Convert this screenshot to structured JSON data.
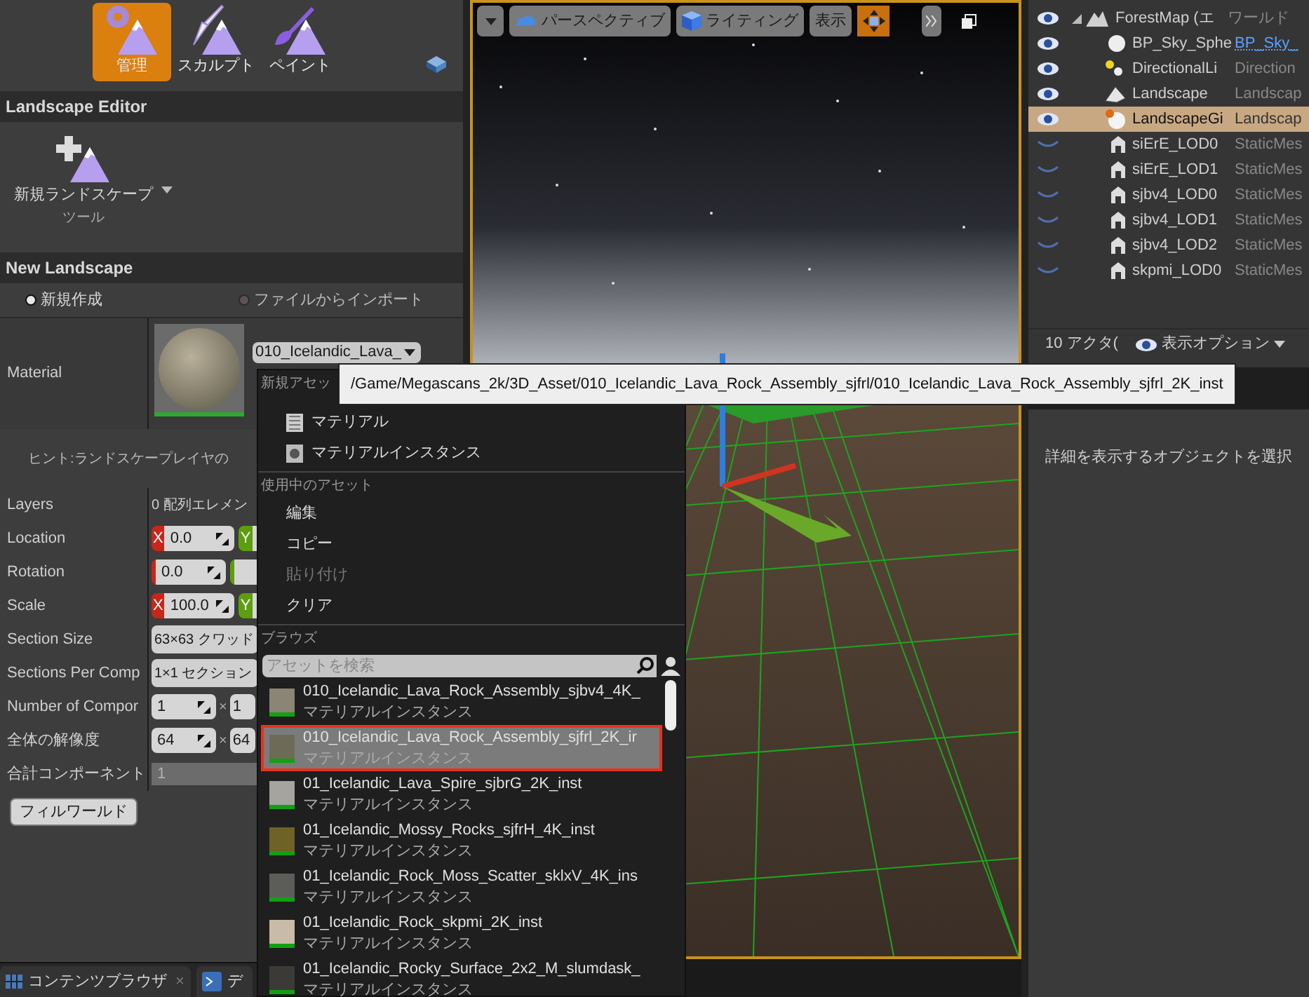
{
  "mode_tabs": [
    {
      "label": "管理",
      "selected": true
    },
    {
      "label": "スカルプト",
      "selected": false
    },
    {
      "label": "ペイント",
      "selected": false
    }
  ],
  "landscape_editor": {
    "title": "Landscape Editor",
    "tool_label": "新規ランドスケープ",
    "tool_sublabel": "ツール"
  },
  "new_landscape": {
    "title": "New Landscape",
    "sources": [
      {
        "label": "新規作成",
        "selected": true
      },
      {
        "label": "ファイルからインポート",
        "selected": false
      }
    ],
    "material": {
      "label": "Material",
      "value": "010_Icelandic_Lava_"
    },
    "hint": "ヒント:ランドスケープレイヤの",
    "properties": [
      {
        "kind": "text",
        "label": "Layers",
        "value": "0 配列エレメン"
      },
      {
        "kind": "vector",
        "label": "Location",
        "fields": [
          {
            "axis": "X",
            "value": "0.0",
            "color": "#c8261a"
          },
          {
            "axis": "Y",
            "color": "#5c9e0e"
          }
        ]
      },
      {
        "kind": "vector",
        "label": "Rotation",
        "fields": [
          {
            "value": "0.0",
            "color": "#c8261a"
          },
          {
            "color": "#5c9e0e"
          }
        ]
      },
      {
        "kind": "vector",
        "label": "Scale",
        "fields": [
          {
            "axis": "X",
            "value": "100.0",
            "color": "#c8261a"
          },
          {
            "axis": "Y",
            "color": "#5c9e0e"
          }
        ]
      },
      {
        "kind": "combo",
        "label": "Section Size",
        "value": "63×63 クワッド"
      },
      {
        "kind": "combo",
        "label": "Sections Per Comp",
        "value": "1×1 セクション"
      },
      {
        "kind": "pair",
        "label": "Number of Compor",
        "values": [
          "1",
          "1"
        ],
        "separator": "×"
      },
      {
        "kind": "pair",
        "label": "全体の解像度",
        "values": [
          "64",
          "64"
        ],
        "separator": "×"
      },
      {
        "kind": "readonly",
        "label": "合計コンポーネント",
        "value": "1"
      }
    ],
    "fill_button": "フィルワールド"
  },
  "bottom_tabs": [
    {
      "label": "コンテンツブラウザ",
      "close": "×"
    },
    {
      "label": "デ"
    }
  ],
  "viewport": {
    "toolbar": [
      {
        "kind": "caret"
      },
      {
        "kind": "button",
        "label": "パースペクティブ"
      },
      {
        "kind": "button",
        "label": "ライティング"
      },
      {
        "kind": "button",
        "label": "表示"
      },
      {
        "kind": "transform",
        "selected": true
      },
      {
        "kind": "more"
      },
      {
        "kind": "maximize"
      }
    ]
  },
  "outliner": {
    "rows": [
      {
        "label": "ForestMap (エ",
        "type": "ワールド",
        "visible": true,
        "selected": false,
        "link": false
      },
      {
        "label": "BP_Sky_Sphe",
        "type": "BP_Sky_",
        "visible": true,
        "selected": false,
        "link": true
      },
      {
        "label": "DirectionalLi",
        "type": "Direction",
        "visible": true,
        "selected": false,
        "link": false
      },
      {
        "label": "Landscape",
        "type": "Landscap",
        "visible": true,
        "selected": false,
        "link": false
      },
      {
        "label": "LandscapeGi",
        "type": "Landscap",
        "visible": true,
        "selected": true,
        "link": false
      },
      {
        "label": "siErE_LOD0",
        "type": "StaticMes",
        "visible": false,
        "selected": false,
        "link": false
      },
      {
        "label": "siErE_LOD1",
        "type": "StaticMes",
        "visible": false,
        "selected": false,
        "link": false
      },
      {
        "label": "sjbv4_LOD0",
        "type": "StaticMes",
        "visible": false,
        "selected": false,
        "link": false
      },
      {
        "label": "sjbv4_LOD1",
        "type": "StaticMes",
        "visible": false,
        "selected": false,
        "link": false
      },
      {
        "label": "sjbv4_LOD2",
        "type": "StaticMes",
        "visible": false,
        "selected": false,
        "link": false
      },
      {
        "label": "skpmi_LOD0",
        "type": "StaticMes",
        "visible": false,
        "selected": false,
        "link": false
      }
    ],
    "count": "10 アクタ(",
    "view_options": "表示オプション"
  },
  "details": {
    "empty_message": "詳細を表示するオブジェクトを選択"
  },
  "asset_menu": {
    "sections": [
      {
        "header": "新規アセッ",
        "items": [
          {
            "label": "マテリアル",
            "disabled": false
          },
          {
            "label": "マテリアルインスタンス",
            "disabled": false
          }
        ]
      },
      {
        "header": "使用中のアセット",
        "items": [
          {
            "label": "編集",
            "disabled": false
          },
          {
            "label": "コピー",
            "disabled": false
          },
          {
            "label": "貼り付け",
            "disabled": true
          },
          {
            "label": "クリア",
            "disabled": false
          }
        ]
      }
    ],
    "browse_header": "ブラウズ",
    "search": {
      "placeholder": "アセットを検索"
    },
    "assets": [
      {
        "name": "010_Icelandic_Lava_Rock_Assembly_sjbv4_4K_",
        "type": "マテリアルインスタンス",
        "selected": false,
        "color": "#8a8574"
      },
      {
        "name": "010_Icelandic_Lava_Rock_Assembly_sjfrl_2K_ir",
        "type": "マテリアルインスタンス",
        "selected": true,
        "color": "#6e6a58"
      },
      {
        "name": "01_Icelandic_Lava_Spire_sjbrG_2K_inst",
        "type": "マテリアルインスタンス",
        "selected": false,
        "color": "#a6a49e"
      },
      {
        "name": "01_Icelandic_Mossy_Rocks_sjfrH_4K_inst",
        "type": "マテリアルインスタンス",
        "selected": false,
        "color": "#6e6226"
      },
      {
        "name": "01_Icelandic_Rock_Moss_Scatter_sklxV_4K_ins",
        "type": "マテリアルインスタンス",
        "selected": false,
        "color": "#5c5c58"
      },
      {
        "name": "01_Icelandic_Rock_skpmi_2K_inst",
        "type": "マテリアルインスタンス",
        "selected": false,
        "color": "#c8bca8"
      },
      {
        "name": "01_Icelandic_Rocky_Surface_2x2_M_slumdask_",
        "type": "マテリアルインスタンス",
        "selected": false,
        "color": "#3c3a36"
      }
    ]
  },
  "tooltip": "/Game/Megascans_2k/3D_Asset/010_Icelandic_Lava_Rock_Assembly_sjfrl/010_Icelandic_Lava_Rock_Assembly_sjfrl_2K_inst"
}
